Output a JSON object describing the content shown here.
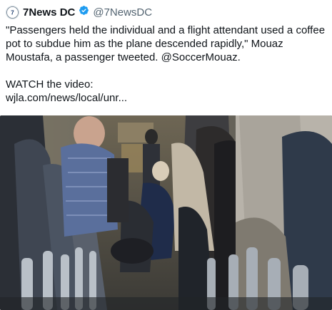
{
  "tweet": {
    "author_name": "7News DC",
    "author_handle": "@7NewsDC",
    "verified_icon": "verified-badge-icon",
    "avatar_icon": "7news-logo-icon",
    "body_line1": "\"Passengers held the individual and a flight attendant used a coffee pot to subdue him as the plane descended rapidly,\" Mouaz Moustafa, a passenger tweeted. @SoccerMouaz.",
    "body_line2": "WATCH the video:",
    "link_text": "wjla.com/news/local/unr...",
    "media_icon": "airplane-cabin-video-thumbnail"
  },
  "colors": {
    "verified": "#1d9bf0",
    "handle": "#536471",
    "text": "#0f1419"
  }
}
